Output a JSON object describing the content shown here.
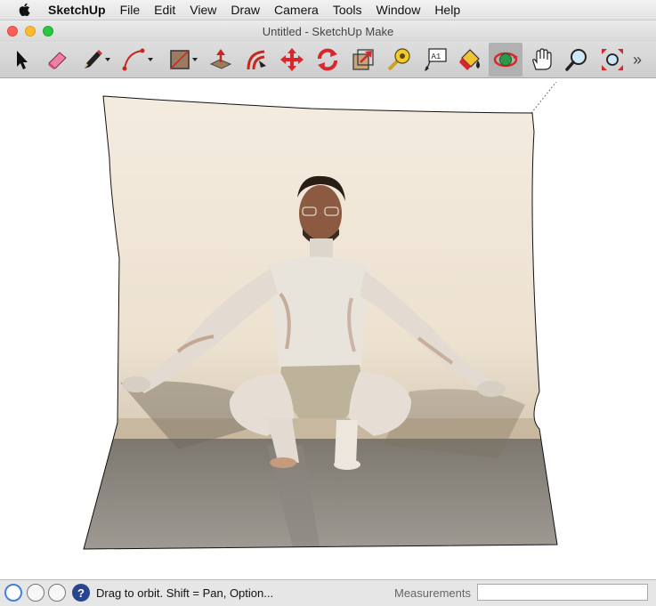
{
  "menu_bar": {
    "apple_icon": "apple-logo-icon",
    "app_name": "SketchUp",
    "items": [
      "File",
      "Edit",
      "View",
      "Draw",
      "Camera",
      "Tools",
      "Window",
      "Help"
    ]
  },
  "window": {
    "title": "Untitled - SketchUp Make",
    "buttons": {
      "close_color": "#fc5f57",
      "minimize_color": "#fdbc2e",
      "zoom_color": "#28c840"
    }
  },
  "toolbar": {
    "tools": [
      {
        "icon": "select-arrow-icon"
      },
      {
        "icon": "eraser-icon"
      },
      {
        "icon": "pencil-line-icon"
      },
      {
        "icon": "arc-icon"
      },
      {
        "icon": "rectangle-icon"
      },
      {
        "icon": "push-pull-icon"
      },
      {
        "icon": "offset-icon"
      },
      {
        "icon": "move-icon"
      },
      {
        "icon": "rotate-icon"
      },
      {
        "icon": "scale-icon"
      },
      {
        "icon": "tape-measure-icon"
      },
      {
        "icon": "text-label-icon"
      },
      {
        "icon": "paint-bucket-icon"
      },
      {
        "icon": "orbit-icon",
        "active": true
      },
      {
        "icon": "pan-hand-icon"
      },
      {
        "icon": "zoom-magnifier-icon"
      },
      {
        "icon": "zoom-extents-icon"
      }
    ],
    "overflow_label": "»",
    "active_tool_bg": "#b1b1b1"
  },
  "canvas": {
    "background": "#ffffff",
    "photo_subject": "man covered in white paint squatting against a wall, photo texture draped on a curved surface"
  },
  "status_bar": {
    "geolocation_icon": "geolocation-pin-icon",
    "credits_icon": "credits-info-icon",
    "user_icon": "user-account-icon",
    "help_label": "?",
    "status_text": "Drag to orbit. Shift = Pan, Option...",
    "measurements_label": "Measurements",
    "measurements_value": ""
  }
}
